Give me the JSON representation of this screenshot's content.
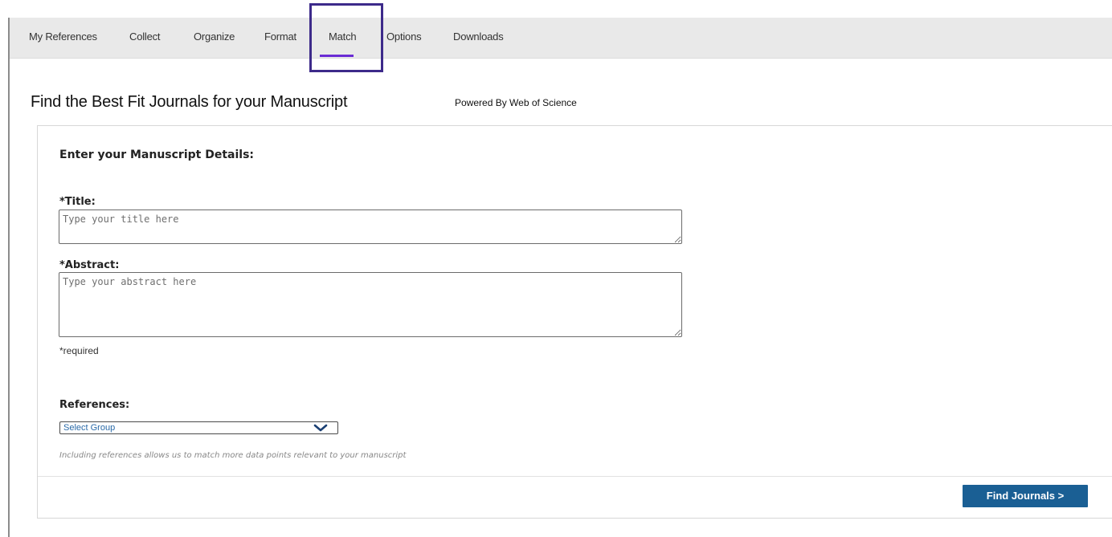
{
  "nav": {
    "tabs": [
      {
        "label": "My References"
      },
      {
        "label": "Collect"
      },
      {
        "label": "Organize"
      },
      {
        "label": "Format"
      },
      {
        "label": "Match",
        "active": true
      },
      {
        "label": "Options"
      },
      {
        "label": "Downloads"
      }
    ],
    "active_tab": "Match",
    "accent_color": "#6a2bd4",
    "highlight_color": "#3d2a8a"
  },
  "page": {
    "title": "Find the Best Fit Journals for your Manuscript",
    "powered_by": "Powered By Web of Science"
  },
  "form": {
    "heading": "Enter your Manuscript Details:",
    "title_label": "*Title:",
    "title_placeholder": "Type your title here",
    "title_value": "",
    "abstract_label": "*Abstract:",
    "abstract_placeholder": "Type your abstract here",
    "abstract_value": "",
    "required_note": "*required",
    "references_label": "References:",
    "references_select": {
      "selected": "Select Group",
      "icon": "chevron-down-icon"
    },
    "references_hint": "Including references allows us to match more data points relevant to your manuscript"
  },
  "actions": {
    "find_journals_label": "Find Journals >",
    "button_color": "#1a5f94"
  }
}
